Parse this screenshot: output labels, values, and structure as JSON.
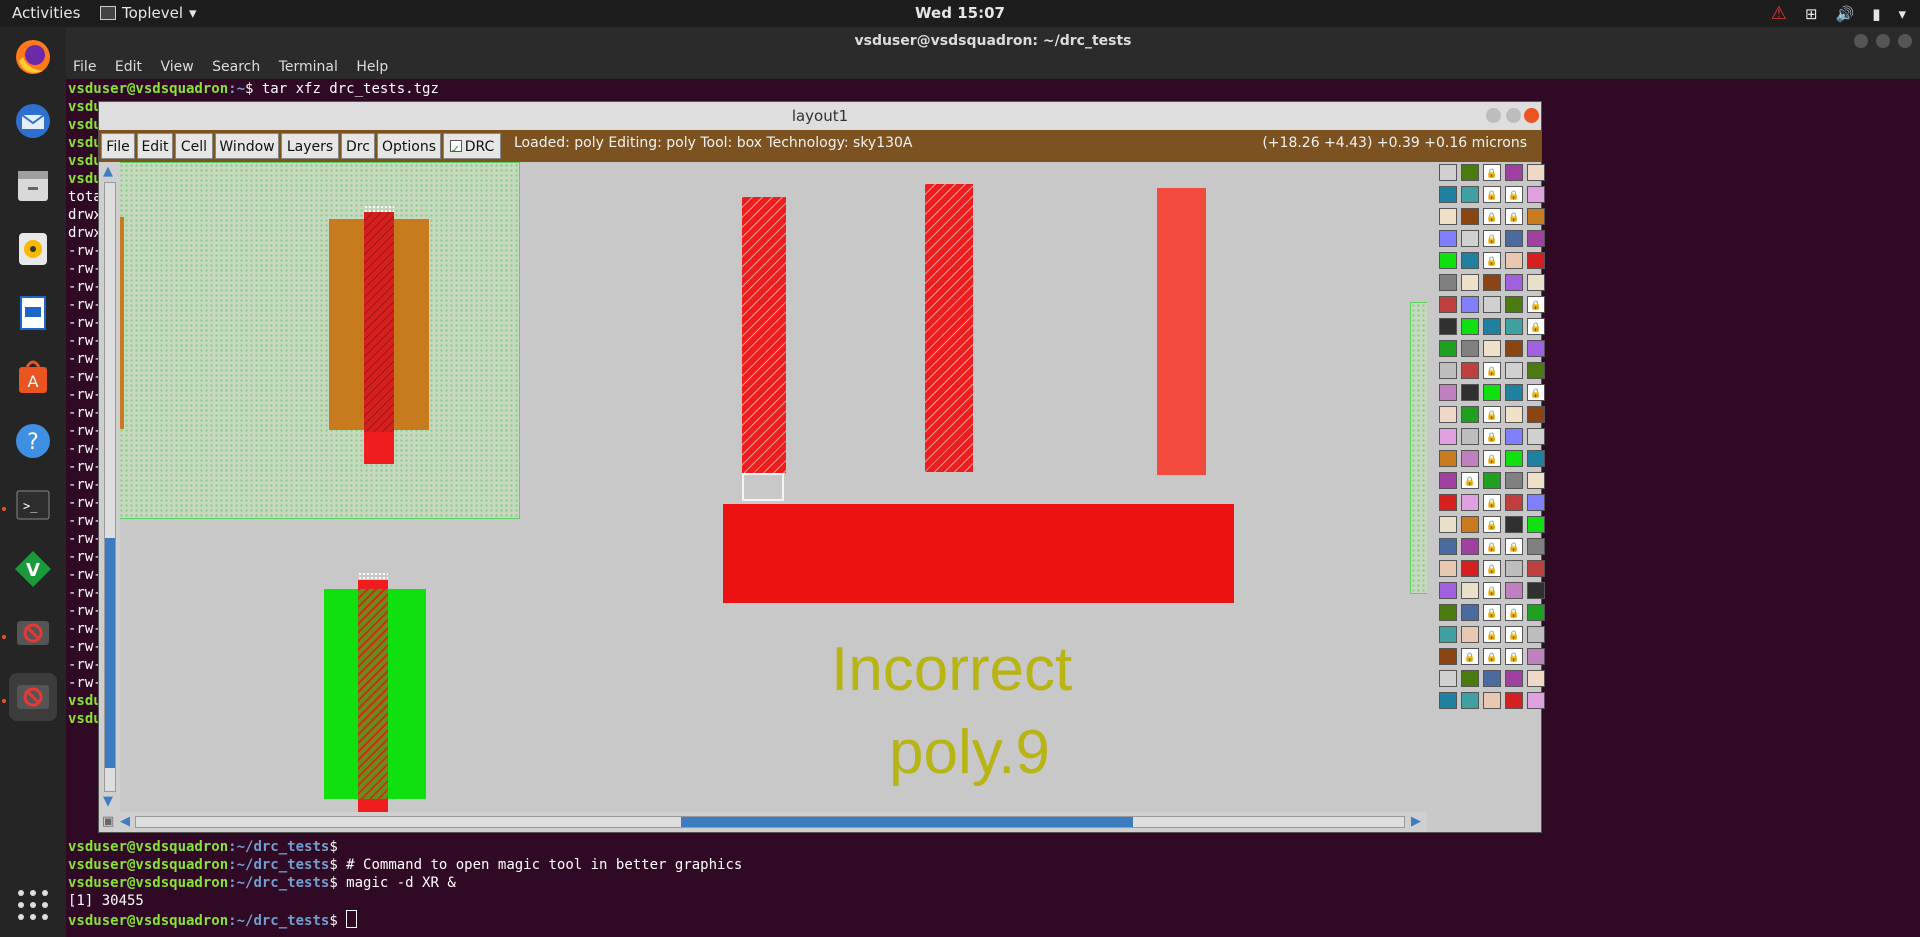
{
  "topbar": {
    "activities": "Activities",
    "app": "Toplevel",
    "clock": "Wed 15:07"
  },
  "terminal": {
    "title": "vsduser@vsdsquadron: ~/drc_tests",
    "menu": [
      "File",
      "Edit",
      "View",
      "Search",
      "Terminal",
      "Help"
    ],
    "first_line": {
      "prompt_user": "vsduser@vsdsquadron",
      "prompt_path": ":~",
      "cmd": "$ tar xfz drc_tests.tgz"
    },
    "left_fragments": [
      "vsdu",
      "vsdu",
      "vsdu",
      "vsdu",
      "vsdu",
      "tota",
      "drwx",
      "drwx",
      "-rw-",
      "-rw-",
      "-rw-",
      "-rw-",
      "-rw-",
      "-rw-",
      "-rw-",
      "-rw-",
      "-rw-",
      "-rw-",
      "-rw-",
      "-rw-",
      "-rw-",
      "-rw-",
      "-rw-",
      "-rw-",
      "-rw-",
      "-rw-",
      "-rw-",
      "-rw-",
      "-rw-",
      "-rw-",
      "-rw-",
      "-rw-",
      "-rw-",
      "vsdu",
      "vsdu"
    ],
    "bottom_lines": [
      {
        "user": "vsduser@vsdsquadron",
        "path": ":~/drc_tests",
        "cmd": "$"
      },
      {
        "user": "vsduser@vsdsquadron",
        "path": ":~/drc_tests",
        "cmd": "$ # Command to open magic tool in better graphics"
      },
      {
        "user": "vsduser@vsdsquadron",
        "path": ":~/drc_tests",
        "cmd": "$ magic -d XR &"
      },
      {
        "user": "",
        "path": "",
        "cmd": "[1] 30455"
      },
      {
        "user": "vsduser@vsdsquadron",
        "path": ":~/drc_tests",
        "cmd": "$ "
      }
    ]
  },
  "magic": {
    "title": "layout1",
    "menu": [
      "File",
      "Edit",
      "Cell",
      "Window",
      "Layers",
      "Drc",
      "Options"
    ],
    "drc_label": "DRC",
    "status": "Loaded: poly Editing: poly Tool: box  Technology: sky130A",
    "coords": "(+18.26 +4.43) +0.39 +0.16 microns",
    "annotation_line1": "Incorrect",
    "annotation_line2": "poly.9"
  },
  "colors": {
    "poly": "#ef1d1d",
    "ndiff": "#10e010",
    "pdiff": "#c87a1e",
    "annotation": "#b7b414",
    "menu_bar": "#7b5220"
  }
}
